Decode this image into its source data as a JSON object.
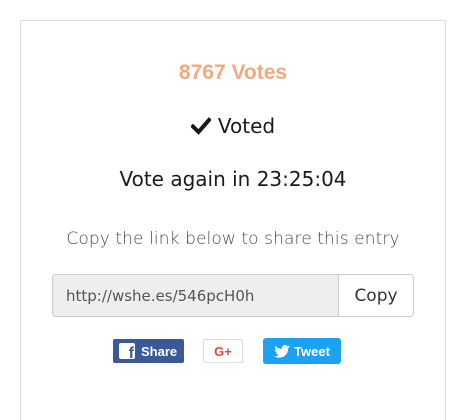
{
  "votes": {
    "count_text": "8767 Votes"
  },
  "status": {
    "voted_label": "Voted",
    "icon": "checkmark-icon"
  },
  "timer": {
    "text": "Vote again in 23:25:04"
  },
  "share": {
    "caption": "Copy the link below to share this entry",
    "link_value": "http://wshe.es/546pcH0h",
    "copy_label": "Copy"
  },
  "social": {
    "facebook_label": "Share",
    "googleplus_label": "G+",
    "twitter_label": "Tweet"
  },
  "colors": {
    "accent": "#f2a97e",
    "facebook": "#3b5998",
    "googleplus": "#dd4b39",
    "twitter": "#1da1f2"
  }
}
